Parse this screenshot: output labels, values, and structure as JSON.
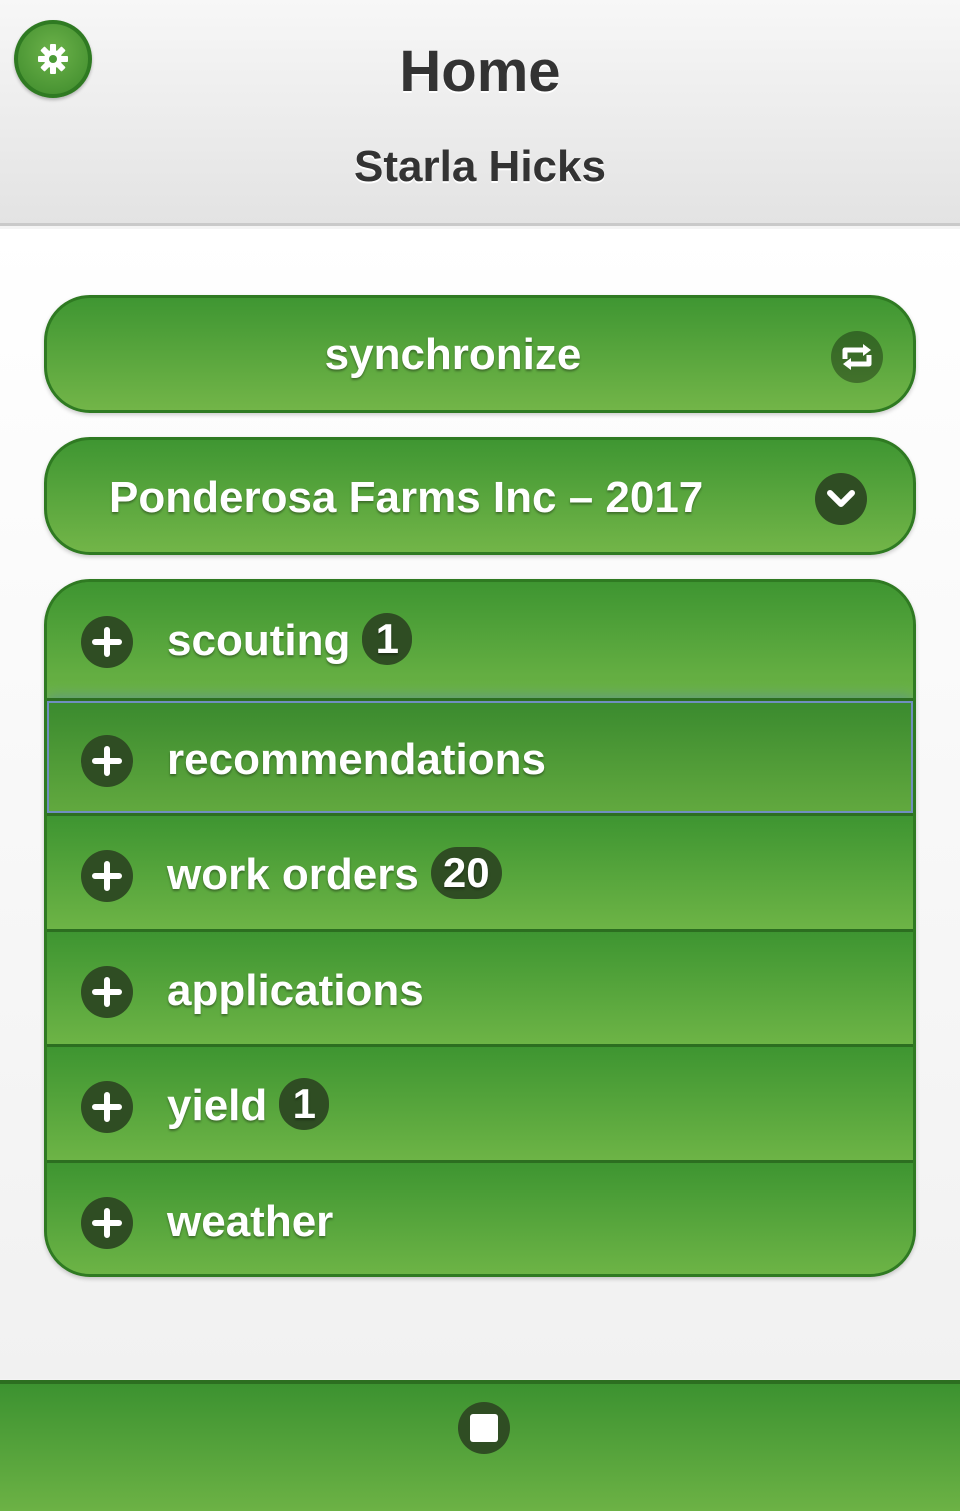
{
  "header": {
    "title": "Home",
    "user": "Starla Hicks",
    "settings_icon": "gear-icon"
  },
  "sync": {
    "label": "synchronize",
    "icon": "sync-icon"
  },
  "farm_select": {
    "label": "Ponderosa Farms Inc – 2017",
    "icon": "chevron-down-icon"
  },
  "menu": {
    "items": [
      {
        "label": "scouting",
        "badge": "1"
      },
      {
        "label": "recommendations",
        "badge": ""
      },
      {
        "label": "work orders",
        "badge": "20"
      },
      {
        "label": "applications",
        "badge": ""
      },
      {
        "label": "yield",
        "badge": "1"
      },
      {
        "label": "weather",
        "badge": ""
      }
    ],
    "item_icon": "plus-icon",
    "active_index": 1
  },
  "footer": {
    "icon": "square-icon"
  },
  "colors": {
    "green_dark": "#3e9531",
    "green_light": "#6db446",
    "badge_bg": "#2f4d23",
    "text_dark": "#333333"
  }
}
